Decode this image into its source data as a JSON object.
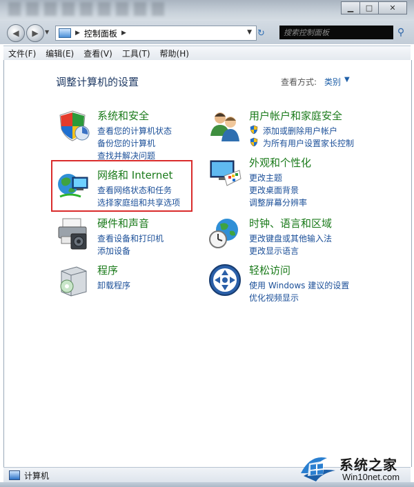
{
  "window": {
    "caption_buttons": [
      "minimize",
      "maximize",
      "close"
    ]
  },
  "address_bar": {
    "breadcrumb": "控制面板",
    "search_placeholder": "搜索控制面板"
  },
  "menu": [
    "文件(F)",
    "编辑(E)",
    "查看(V)",
    "工具(T)",
    "帮助(H)"
  ],
  "page": {
    "title": "调整计算机的设置",
    "view_by_label": "查看方式:",
    "view_by_value": "类别"
  },
  "categories": {
    "system": {
      "title": "系统和安全",
      "links": [
        "查看您的计算机状态",
        "备份您的计算机",
        "查找并解决问题"
      ],
      "icon": "shield-icon"
    },
    "network": {
      "title": "网络和 Internet",
      "links": [
        "查看网络状态和任务",
        "选择家庭组和共享选项"
      ],
      "icon": "network-globe-icon",
      "highlighted": true,
      "highlight_color": "#d92b2b"
    },
    "hardware": {
      "title": "硬件和声音",
      "links": [
        "查看设备和打印机",
        "添加设备"
      ],
      "icon": "printer-icon"
    },
    "programs": {
      "title": "程序",
      "links": [
        "卸载程序"
      ],
      "icon": "programs-box-icon"
    },
    "users": {
      "title": "用户帐户和家庭安全",
      "links": [
        "添加或删除用户帐户",
        "为所有用户设置家长控制"
      ],
      "icon": "users-icon"
    },
    "appearance": {
      "title": "外观和个性化",
      "links": [
        "更改主题",
        "更改桌面背景",
        "调整屏幕分辨率"
      ],
      "icon": "monitor-palette-icon"
    },
    "clock": {
      "title": "时钟、语言和区域",
      "links": [
        "更改键盘或其他输入法",
        "更改显示语言"
      ],
      "icon": "clock-globe-icon"
    },
    "ease": {
      "title": "轻松访问",
      "links": [
        "使用 Windows 建议的设置",
        "优化视频显示"
      ],
      "icon": "ease-of-access-icon"
    }
  },
  "status_bar": {
    "text": "计算机"
  },
  "watermark": {
    "title": "系统之家",
    "url": "Win10net.com"
  },
  "colors": {
    "category_title": "#1a7a1a",
    "link": "#1b4f98",
    "page_title": "#1f3a64"
  }
}
